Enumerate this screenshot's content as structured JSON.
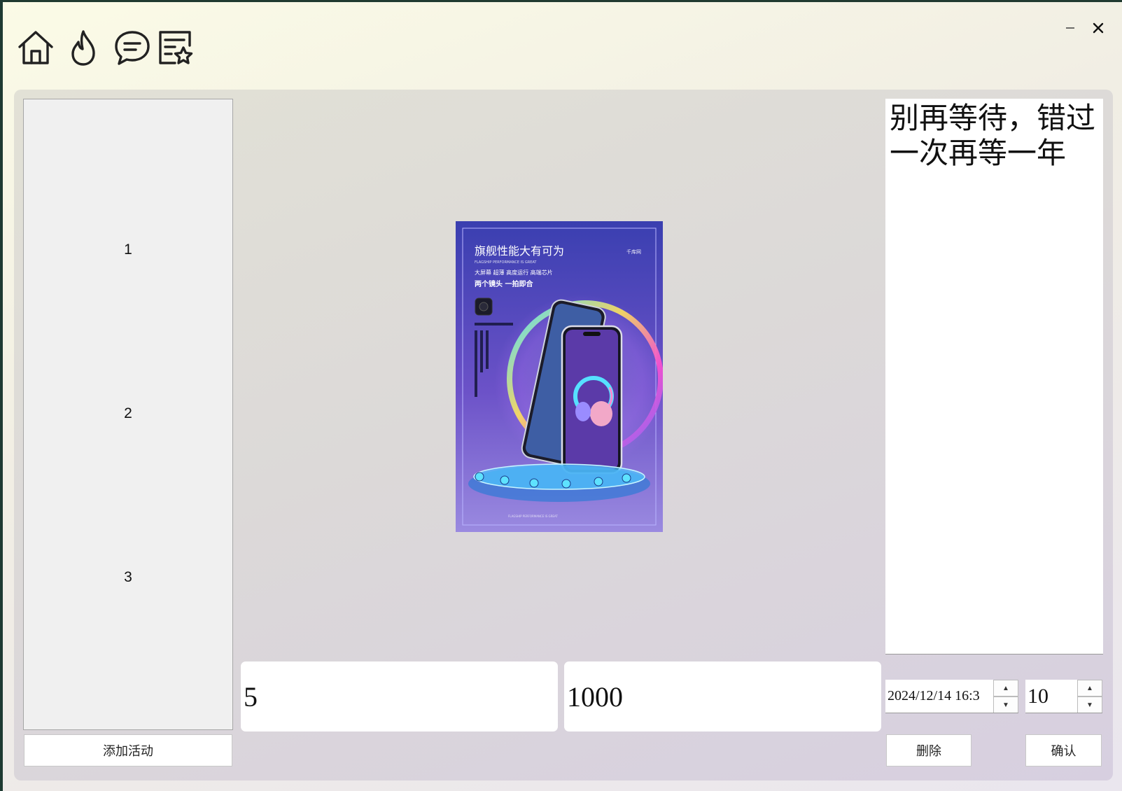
{
  "toolbar": {
    "icons": [
      "home-icon",
      "flame-icon",
      "chat-icon",
      "favorites-list-icon"
    ]
  },
  "window_controls": {
    "minimize": "minimize-icon",
    "close": "close-icon"
  },
  "activity_list": {
    "items": [
      "1",
      "2",
      "3"
    ]
  },
  "add_button_label": "添加活动",
  "poster": {
    "title": "旗舰性能大有可为",
    "subtitle": "FLAGSHIP PERFORMANCE IS GREAT",
    "features": "大屏幕   超薄   高度运行    高端芯片",
    "tagline": "两个镜头    一拍即合",
    "logo": "千库网"
  },
  "description": "别再等待，错过一次再等一年",
  "fields": {
    "first_value": "5",
    "second_value": "1000"
  },
  "datetime_value": "2024/12/14  16:3",
  "quantity_value": "10",
  "delete_button_label": "删除",
  "confirm_button_label": "确认",
  "colors": {
    "panel": "#dcd9d8",
    "list_bg": "#f0f0f0",
    "input_bg": "#ffffff"
  }
}
